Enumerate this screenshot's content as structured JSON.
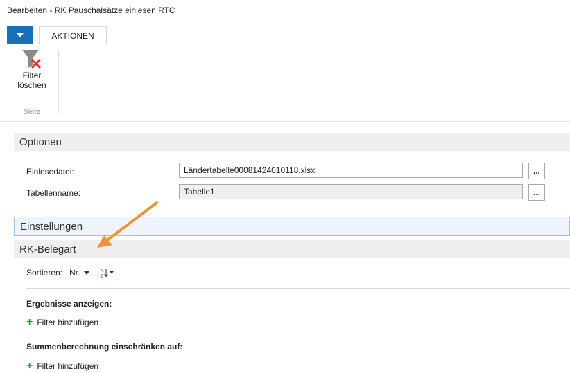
{
  "window": {
    "title": "Bearbeiten - RK Pauschalsätze einlesen RTC"
  },
  "ribbon": {
    "tab_label": "AKTIONEN",
    "filter_button_line1": "Filter",
    "filter_button_line2": "löschen",
    "group_label": "Seite"
  },
  "optionen": {
    "header": "Optionen",
    "fields": [
      {
        "label": "Einlesedatei:",
        "value": "Ländertabelle00081424010118.xlsx",
        "button": "..."
      },
      {
        "label": "Tabellenname:",
        "value": "Tabelle1",
        "button": "..."
      }
    ]
  },
  "einstellungen": {
    "header": "Einstellungen"
  },
  "belegart": {
    "header": "RK-Belegart",
    "sort_label": "Sortieren:",
    "sort_value": "Nr.",
    "results_label": "Ergebnisse anzeigen:",
    "add_filter_1": "Filter hinzufügen",
    "totals_label": "Summenberechnung einschränken auf:",
    "add_filter_2": "Filter hinzufügen"
  },
  "colors": {
    "accent": "#1b6fb8",
    "annotation_arrow": "#f0923a",
    "plus": "#2e9a3b"
  }
}
